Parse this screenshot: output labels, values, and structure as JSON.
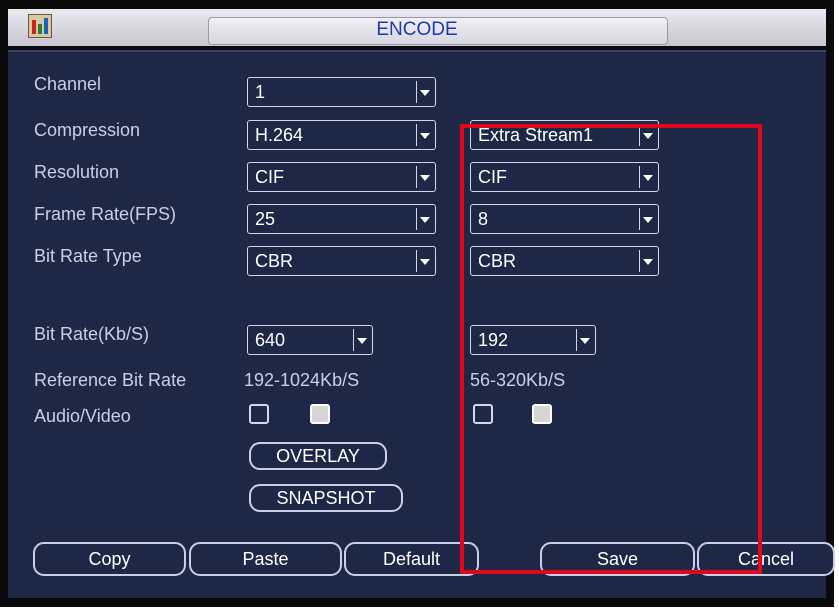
{
  "window": {
    "title": "ENCODE",
    "icon": "film-icon"
  },
  "labels": {
    "channel": "Channel",
    "compression": "Compression",
    "resolution": "Resolution",
    "frame_rate": "Frame Rate(FPS)",
    "bit_rate_type": "Bit Rate Type",
    "bit_rate": "Bit Rate(Kb/S)",
    "reference_bit_rate": "Reference Bit Rate",
    "audio_video": "Audio/Video"
  },
  "main_stream": {
    "channel": "1",
    "compression": "H.264",
    "resolution": "CIF",
    "frame_rate": "25",
    "bit_rate_type": "CBR",
    "bit_rate": "640",
    "reference_bit_rate": "192-1024Kb/S",
    "audio_checked": false,
    "video_checked": true
  },
  "extra_stream": {
    "stream": "Extra Stream1",
    "resolution": "CIF",
    "frame_rate": "8",
    "bit_rate_type": "CBR",
    "bit_rate": "192",
    "reference_bit_rate": "56-320Kb/S",
    "audio_checked": false,
    "video_checked": true
  },
  "buttons": {
    "overlay": "OVERLAY",
    "snapshot": "SNAPSHOT",
    "copy": "Copy",
    "paste": "Paste",
    "default": "Default",
    "save": "Save",
    "cancel": "Cancel"
  },
  "colors": {
    "panel_bg": "#1e2846",
    "title_text": "#1e3aa8",
    "highlight_box": "#e0061b",
    "label_text": "#c8d0e4"
  }
}
